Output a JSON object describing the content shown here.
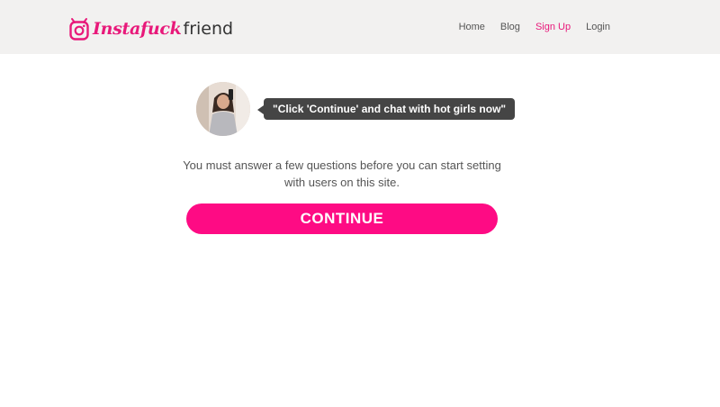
{
  "brand": {
    "logo_script": "Instafuck",
    "logo_plain": "friend",
    "accent_color": "#fe0b84"
  },
  "nav": {
    "items": [
      {
        "label": "Home",
        "active": false
      },
      {
        "label": "Blog",
        "active": false
      },
      {
        "label": "Sign Up",
        "active": true
      },
      {
        "label": "Login",
        "active": false
      }
    ]
  },
  "main": {
    "bubble_text": "\"Click 'Continue' and chat with hot girls now\"",
    "message": "You must answer a few questions before you can start setting with users on this site.",
    "continue_label": "CONTINUE"
  },
  "icons": {
    "logo": "instagram-camera-icon",
    "avatar": "profile-photo"
  }
}
